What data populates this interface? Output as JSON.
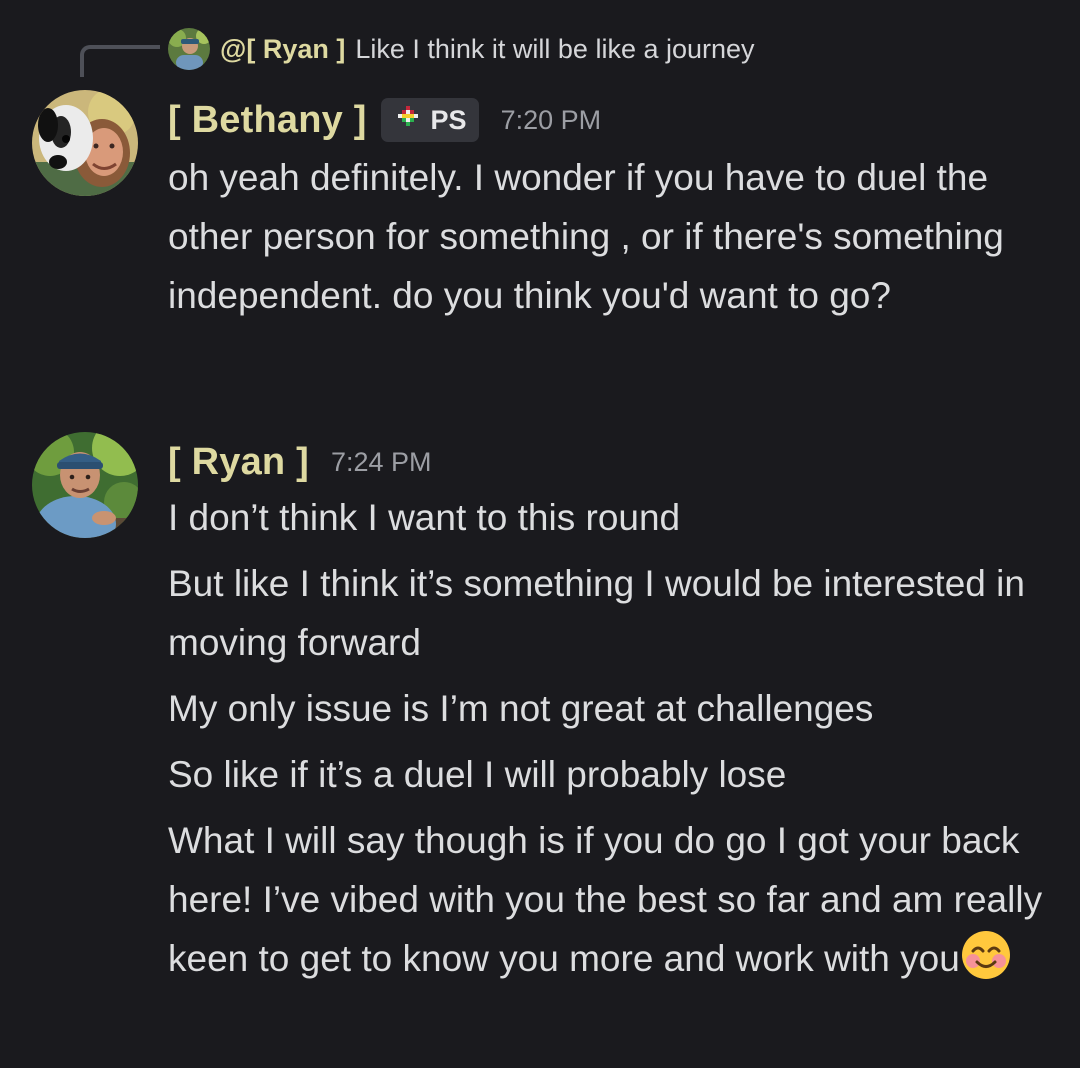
{
  "reply": {
    "mention": "@[ Ryan ]",
    "text": "Like I think it will be like a journey"
  },
  "messages": [
    {
      "author": "[ Bethany ]",
      "tag": "PS",
      "time": "7:20 PM",
      "lines": [
        "oh yeah definitely. I wonder if you have to duel the other person for something , or if there's something independent. do you think you'd want to go?"
      ]
    },
    {
      "author": "[ Ryan ]",
      "time": "7:24 PM",
      "lines": [
        "I don’t think I want to this round",
        "But like I think it’s something I would be interested in moving forward",
        "My only issue is I’m not great at challenges",
        "So like if it’s a duel I will probably lose",
        "What I will say though is if you do go I got your back here! I’ve vibed with you the best so far and am really keen to get to know you more and work with you"
      ],
      "last_line_emoji": "smiling-face-with-blushing-cheeks"
    }
  ],
  "colors": {
    "background": "#1a1a1e",
    "username": "#ded9a1",
    "message_text": "#dcdddf",
    "timestamp": "#9c9ea4",
    "tag_background": "#34353b",
    "reply_line": "#4e5058"
  },
  "icons": {
    "reply_avatar": "user-avatar-ryan",
    "bethany_avatar": "user-avatar-bethany",
    "ryan_avatar": "user-avatar-ryan",
    "tag_icon": "guild-tag-icon"
  }
}
